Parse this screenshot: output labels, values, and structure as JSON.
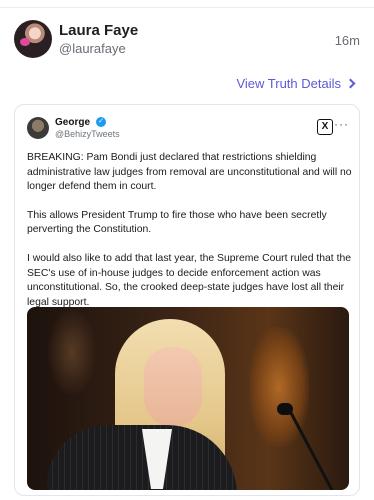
{
  "post": {
    "author_name": "Laura Faye",
    "author_handle": "@laurafaye",
    "timestamp": "16m",
    "details_link": "View Truth Details"
  },
  "embed": {
    "author_name": "George",
    "author_handle": "@BehizyTweets",
    "paragraphs": [
      "BREAKING: Pam Bondi just declared that restrictions shielding administrative law judges from removal are unconstitutional and will no longer defend them in court.",
      "This allows President Trump to fire those who have been secretly perverting the Constitution.",
      "I would also like to add that last year, the Supreme Court ruled that the SEC's use of in-house judges to decide enforcement action was unconstitutional. So, the crooked deep-state judges have lost all their legal support."
    ],
    "x_logo": "X",
    "more": "···"
  },
  "icons": {
    "details_chevron": "chevron-right-icon",
    "verified": "verified-badge-icon",
    "x_logo": "x-logo-icon",
    "more": "more-options-icon"
  },
  "colors": {
    "accent": "#5b5bd6",
    "verified": "#1d9bf0"
  }
}
